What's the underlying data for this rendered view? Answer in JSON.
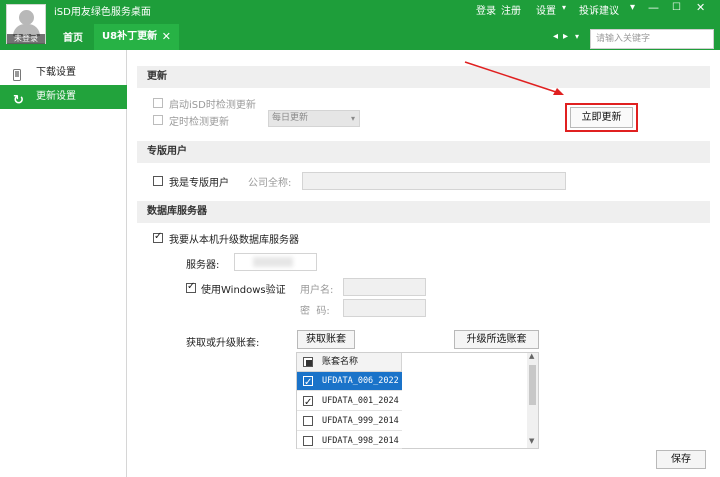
{
  "header": {
    "app_title": "iSD用友绿色服务桌面",
    "avatar_label": "未登录",
    "tabs": [
      {
        "label": "首页"
      },
      {
        "label": "U8补丁更新"
      }
    ],
    "links": {
      "login": "登录",
      "register": "注册",
      "settings": "设置",
      "complaint": "投诉建议"
    },
    "search_placeholder": "请输入关键字"
  },
  "sidebar": {
    "items": [
      {
        "label": "下载设置",
        "active": false
      },
      {
        "label": "更新设置",
        "active": true
      }
    ]
  },
  "update_section": {
    "title": "更新",
    "check_on_start": "启动iSD时检测更新",
    "timed_check": "定时检测更新",
    "frequency": "每日更新",
    "update_now_button": "立即更新"
  },
  "pro_section": {
    "title": "专版用户",
    "is_pro_user": "我是专版用户",
    "company_label": "公司全称:"
  },
  "db_section": {
    "title": "数据库服务器",
    "upgrade_local": "我要从本机升级数据库服务器",
    "server_label": "服务器:",
    "use_windows_auth": "使用Windows验证",
    "username_label": "用户名:",
    "password_label": "密  码:",
    "accounts_label": "获取或升级账套:",
    "get_accounts_button": "获取账套",
    "upgrade_selected_button": "升级所选账套",
    "grid_header": "账套名称",
    "accounts": [
      {
        "name": "UFDATA_006_2022",
        "checked": true,
        "selected": true
      },
      {
        "name": "UFDATA_001_2024",
        "checked": true,
        "selected": false
      },
      {
        "name": "UFDATA_999_2014",
        "checked": false,
        "selected": false
      },
      {
        "name": "UFDATA_998_2014",
        "checked": false,
        "selected": false
      }
    ]
  },
  "footer": {
    "save_button": "保存"
  },
  "colors": {
    "brand_green": "#1e9e3a",
    "active_tab_green": "#27b245",
    "highlight_red": "#e02020",
    "selection_blue": "#1a73c9"
  }
}
